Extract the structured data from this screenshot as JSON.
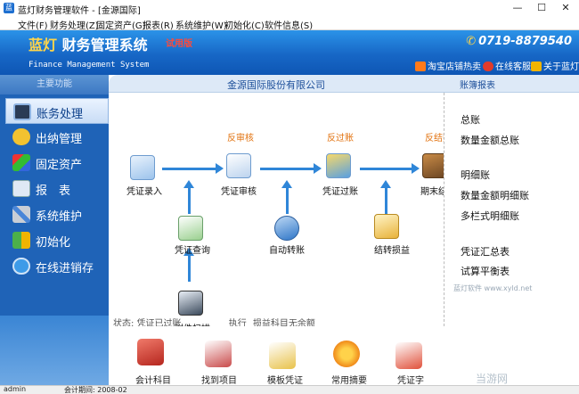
{
  "window": {
    "title": "蓝灯财务管理软件 - [金源国际]",
    "minimize": "—",
    "maximize": "☐",
    "close": "✕"
  },
  "menu": [
    "文件(F)",
    "财务处理(Z)",
    "固定资产(G)",
    "报表(R)",
    "系统维护(W)",
    "初始化(C)",
    "软件信息(S)"
  ],
  "header": {
    "brand_a": "蓝灯",
    "brand_b": "财务管理系统",
    "trial": "试用版",
    "subtitle": "Finance Management System",
    "phone": "0719-8879540",
    "links": [
      "淘宝店铺热卖",
      "在线客服",
      "关于蓝灯"
    ]
  },
  "sidebar": {
    "header": "主要功能",
    "items": [
      {
        "label": "账务处理",
        "icon": "monitor-icon",
        "active": true
      },
      {
        "label": "出纳管理",
        "icon": "coins-icon"
      },
      {
        "label": "固定资产",
        "icon": "cube-icon"
      },
      {
        "label": "报　表",
        "icon": "report-icon"
      },
      {
        "label": "系统维护",
        "icon": "tools-icon"
      },
      {
        "label": "初始化",
        "icon": "puzzle-icon"
      },
      {
        "label": "在线进销存",
        "icon": "ie-icon"
      }
    ]
  },
  "center": {
    "title": "金源国际股份有限公司",
    "flow": {
      "voucher_entry": "凭证录入",
      "voucher_audit": "凭证审核",
      "voucher_post": "凭证过账",
      "period_close": "期末结账",
      "unaudit": "反审核",
      "unpost": "反过账",
      "unclose": "反结账",
      "voucher_query": "凭证查询",
      "auto_transfer": "自动转账",
      "pl_transfer": "结转损益",
      "attach_scan": "附件扫描"
    },
    "status": [
      "状态: 凭证已过账",
      "执行",
      "损益科目无余额"
    ]
  },
  "right": {
    "title": "账簿报表",
    "reports": [
      "总账",
      "数量金额总账",
      "明细账",
      "数量金额明细账",
      "多栏式明细账",
      "凭证汇总表",
      "试算平衡表"
    ],
    "watermark": "蓝灯软件 www.xyld.net"
  },
  "bottom": {
    "items": [
      "会计科目",
      "找到项目",
      "模板凭证",
      "常用摘要",
      "凭证字"
    ],
    "watermark": "当游网"
  },
  "statusbar": {
    "user": "admin",
    "period": "会计期间: 2008-02"
  },
  "colors": {
    "header_blue": "#1767c6",
    "accent_orange": "#e2720f",
    "arrow_blue": "#2f86d8",
    "trial_red": "#ff4a3a"
  }
}
